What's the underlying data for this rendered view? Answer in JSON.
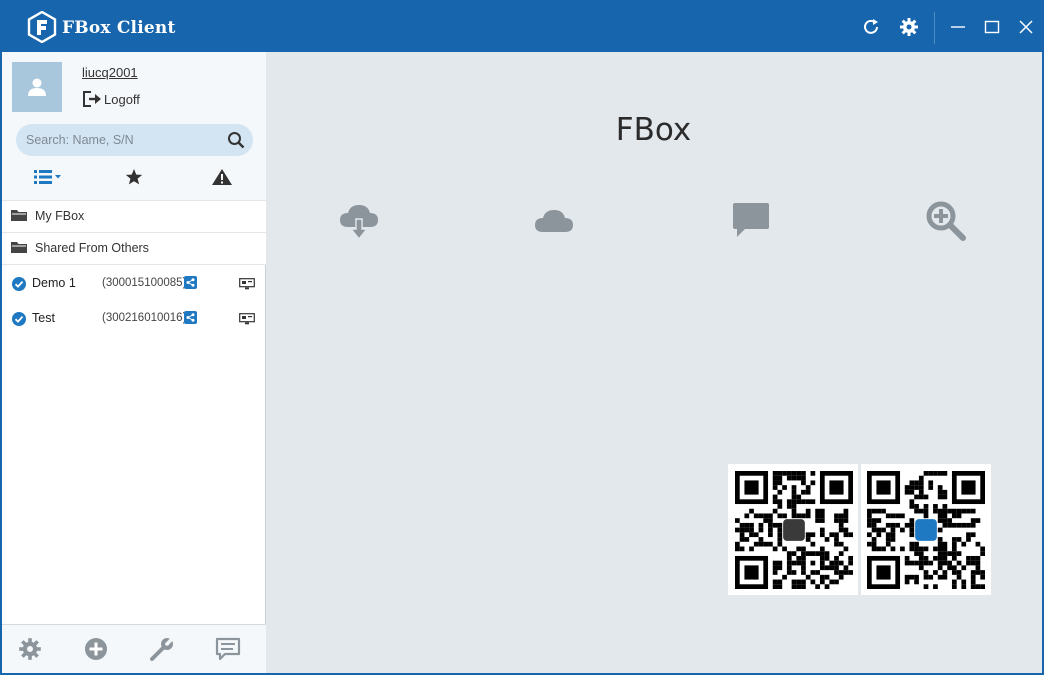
{
  "window": {
    "title": "FBox Client"
  },
  "titlebar": {
    "icons": [
      "refresh-icon",
      "settings-icon",
      "minimize-icon",
      "maximize-icon",
      "close-icon"
    ]
  },
  "user": {
    "name": "liucq2001",
    "logoff_label": "Logoff"
  },
  "search": {
    "placeholder": "Search: Name, S/N"
  },
  "filters": [
    "list-view-icon",
    "star-icon",
    "warning-icon"
  ],
  "folders": [
    {
      "label": "My FBox"
    },
    {
      "label": "Shared From Others"
    }
  ],
  "devices": [
    {
      "name": "Demo 1",
      "sn": "(300015100085)"
    },
    {
      "name": "Test",
      "sn": "(300216010016)"
    }
  ],
  "footer": [
    "settings-icon",
    "add-icon",
    "wrench-icon",
    "message-icon"
  ],
  "main": {
    "title": "FBox",
    "features": [
      "cloud-download-icon",
      "cloud-icon",
      "chat-icon",
      "zoom-in-icon"
    ]
  },
  "colors": {
    "accent": "#1766ad",
    "check": "#1f79c2",
    "icon_gray": "#8c959c",
    "panel_bg": "#e3e8ed"
  }
}
